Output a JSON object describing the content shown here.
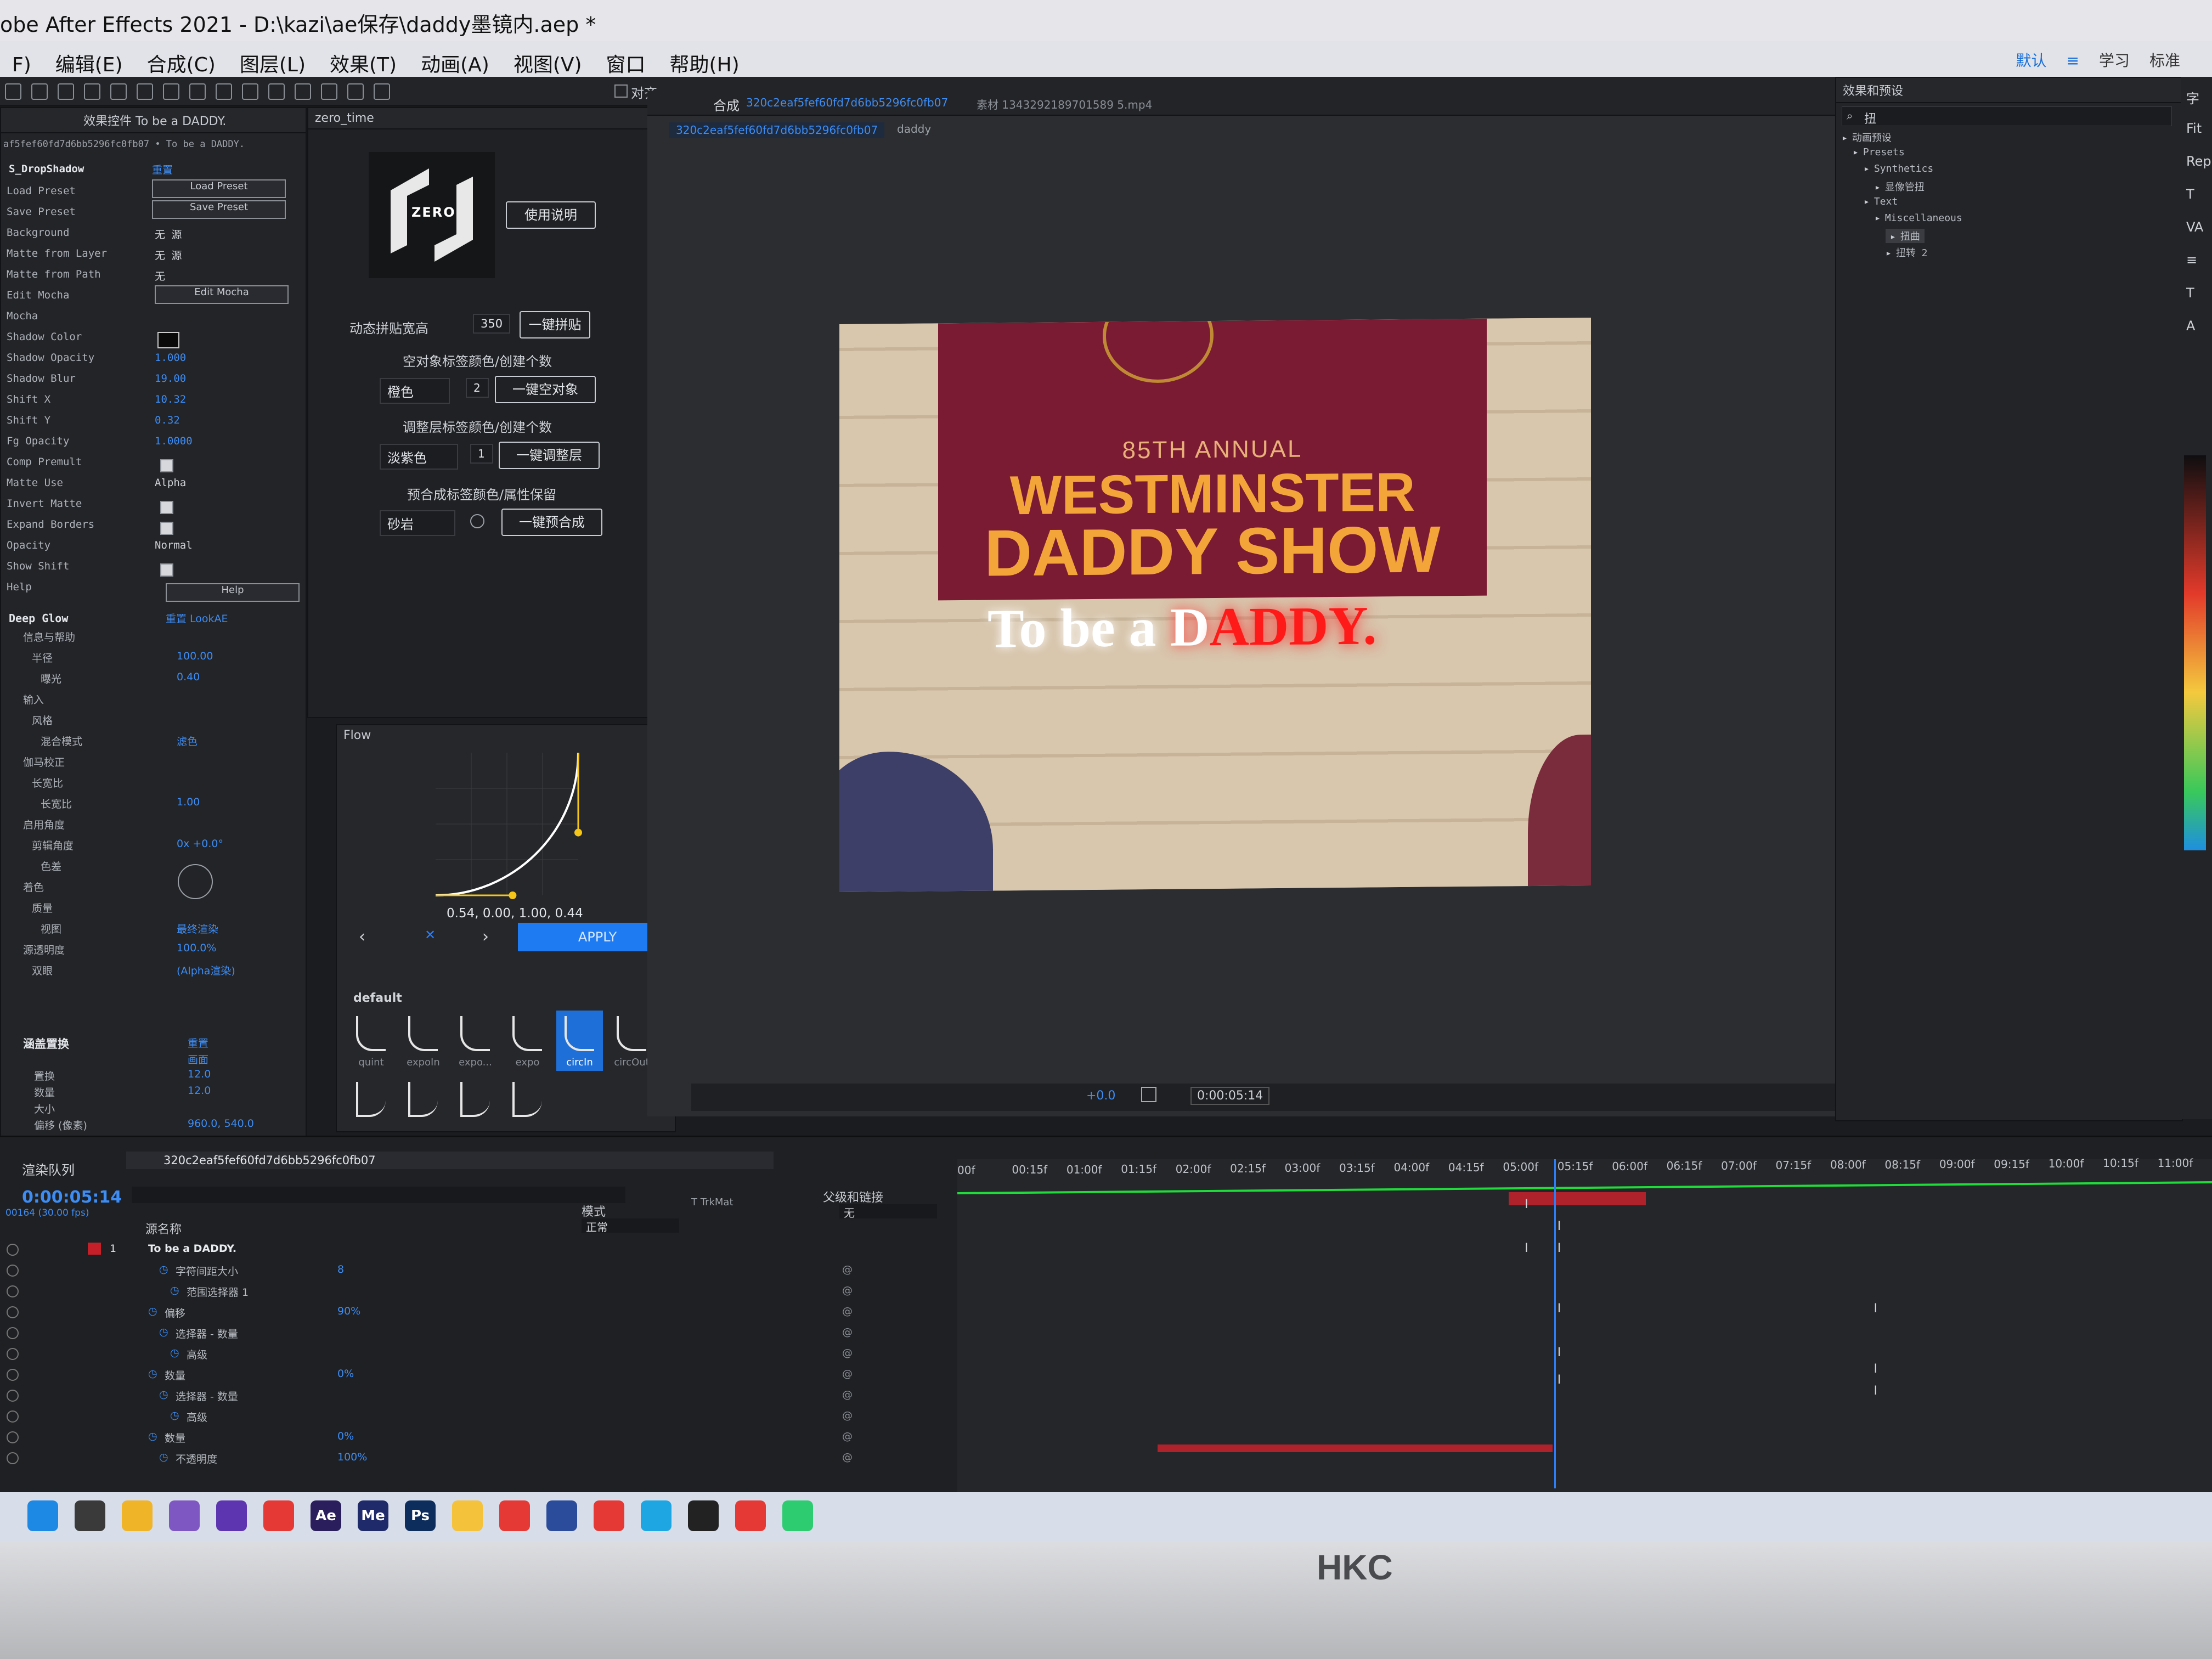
{
  "window": {
    "title": "obe After Effects 2021 - D:\\kazi\\ae保存\\daddy墨镜内.aep *"
  },
  "menu": {
    "items": [
      "F)",
      "编辑(E)",
      "合成(C)",
      "图层(L)",
      "效果(T)",
      "动画(A)",
      "视图(V)",
      "窗口",
      "帮助(H)"
    ],
    "workspace": [
      "默认",
      "≡",
      "学习",
      "标准"
    ]
  },
  "toolbar": {
    "align_label": "对齐"
  },
  "effect_controls": {
    "tab_title": "效果控件 To be a DADDY.",
    "layer_path": "af5fef60fd7d6bb5296fc0fb07 • To be a DADDY.",
    "section1": "S_DropShadow",
    "reset": "重置",
    "load_preset": "Load Preset",
    "save_preset": "Save Preset",
    "edit_mocha": "Edit Mocha",
    "help_button": "Help",
    "rows": [
      {
        "label": "Load Preset",
        "value": ""
      },
      {
        "label": "Save Preset",
        "value": ""
      },
      {
        "label": "Background",
        "value": "无   源"
      },
      {
        "label": "Matte from Layer",
        "value": "无   源"
      },
      {
        "label": "Matte from Path",
        "value": "无"
      },
      {
        "label": "Edit Mocha",
        "value": ""
      },
      {
        "label": "Mocha",
        "value": ""
      },
      {
        "label": "Shadow Color",
        "value": ""
      },
      {
        "label": "Shadow Opacity",
        "value": "1.000"
      },
      {
        "label": "Shadow Blur",
        "value": "19.00"
      },
      {
        "label": "Shift X",
        "value": "10.32"
      },
      {
        "label": "Shift Y",
        "value": "0.32"
      },
      {
        "label": "Fg Opacity",
        "value": "1.0000"
      },
      {
        "label": "Comp Premult",
        "value": ""
      },
      {
        "label": "Matte Use",
        "value": "Alpha"
      },
      {
        "label": "Invert Matte",
        "value": ""
      },
      {
        "label": "Expand Borders",
        "value": ""
      },
      {
        "label": "Opacity",
        "value": "Normal"
      },
      {
        "label": "Show Shift",
        "value": ""
      },
      {
        "label": "Help",
        "value": ""
      }
    ],
    "section2": "Deep Glow",
    "section2_links": "重置   LookAE",
    "rows2": [
      {
        "label": "信息与帮助",
        "value": ""
      },
      {
        "label": "半径",
        "value": "100.00"
      },
      {
        "label": "曝光",
        "value": "0.40"
      },
      {
        "label": "输入",
        "value": ""
      },
      {
        "label": "风格",
        "value": ""
      },
      {
        "label": "混合模式",
        "value": "滤色"
      },
      {
        "label": "伽马校正",
        "value": ""
      },
      {
        "label": "长宽比",
        "value": ""
      },
      {
        "label": "长宽比",
        "value": "1.00"
      },
      {
        "label": "启用角度",
        "value": ""
      },
      {
        "label": "剪辑角度",
        "value": "0x +0.0°"
      },
      {
        "label": "色差",
        "value": ""
      },
      {
        "label": "着色",
        "value": ""
      },
      {
        "label": "质量",
        "value": ""
      },
      {
        "label": "视图",
        "value": "最终渲染"
      },
      {
        "label": "源透明度",
        "value": "100.0%"
      },
      {
        "label": "双眼",
        "value": "(Alpha渲染)"
      }
    ],
    "section3": "涵盖置换",
    "section3_reset": "重置",
    "rows3": [
      {
        "label": "",
        "value": "画面"
      },
      {
        "label": "置换",
        "value": "12.0"
      },
      {
        "label": "数量",
        "value": "12.0"
      },
      {
        "label": "大小",
        "value": ""
      },
      {
        "label": "偏移 (像素)",
        "value": "960.0, 540.0"
      }
    ]
  },
  "zero_panel": {
    "tab": "zero_time",
    "logo_text": "ZERO",
    "manual_button": "使用说明",
    "tile_label": "动态拼贴宽高",
    "tile_value": "350",
    "tile_button": "一键拼贴",
    "null_label": "空对象标签颜色/创建个数",
    "null_color": "橙色",
    "null_count": "2",
    "null_button": "一键空对象",
    "adj_label": "调整层标签颜色/创建个数",
    "adj_color": "淡紫色",
    "adj_count": "1",
    "adj_button": "一键调整层",
    "precomp_label": "预合成标签颜色/属性保留",
    "precomp_color": "砂岩",
    "precomp_button": "一键预合成"
  },
  "flow_panel": {
    "title": "Flow",
    "bezier": "0.54, 0.00, 1.00, 0.44",
    "apply": "APPLY",
    "preset_group": "default",
    "presets": [
      "quint",
      "expoIn",
      "expo...",
      "expo",
      "circIn",
      "circOut"
    ],
    "curve": [
      0.54,
      0.0,
      1.0,
      0.44
    ]
  },
  "composition": {
    "tab_label": "合成",
    "comp_name": "320c2eaf5fef60fd7d6bb5296fc0fb07",
    "footage_tab": "素材 1343292189701589 5.mp4",
    "breadcrumb_child": "daddy",
    "timecode": "0:00:05:14",
    "zoom_offset": "+0.0"
  },
  "video": {
    "banner_line1": "85TH ANNUAL",
    "banner_line2": "WESTMINSTER",
    "banner_line3": "DADDY SHOW",
    "overlay_white": "To be a ",
    "overlay_d": "D",
    "overlay_red": "ADDY."
  },
  "effects_presets": {
    "title": "效果和预设",
    "search_value": "扭",
    "tree": [
      "动画预设",
      "Presets",
      "Synthetics",
      "显像管扭",
      "Text",
      "Miscellaneous",
      "扭曲",
      "扭转 2"
    ]
  },
  "right_panel": {
    "items": [
      "字",
      "Fit",
      "Rep",
      "T",
      "VA",
      "≡",
      "T",
      "A"
    ]
  },
  "timeline": {
    "render_queue": "渲染队列",
    "comp_tab": "320c2eaf5fef60fd7d6bb5296fc0fb07",
    "timecode": "0:00:05:14",
    "frame_info": "00164 (30.00 fps)",
    "col_source": "源名称",
    "col_mode": "模式",
    "col_trkmat": "T  TrkMat",
    "col_parent": "父级和链接",
    "layer_mode": "正常",
    "parent_none": "无",
    "layers": [
      {
        "num": "1",
        "name": "To be a DADDY.",
        "value": ""
      },
      {
        "num": "",
        "name": "字符间距大小",
        "value": "8"
      },
      {
        "num": "",
        "name": "范围选择器 1",
        "value": ""
      },
      {
        "num": "",
        "name": "偏移",
        "value": "90%"
      },
      {
        "num": "",
        "name": "选择器 - 数量",
        "value": ""
      },
      {
        "num": "",
        "name": "高级",
        "value": ""
      },
      {
        "num": "",
        "name": "数量",
        "value": "0%"
      },
      {
        "num": "",
        "name": "选择器 - 数量",
        "value": ""
      },
      {
        "num": "",
        "name": "高级",
        "value": ""
      },
      {
        "num": "",
        "name": "数量",
        "value": "0%"
      },
      {
        "num": "",
        "name": "不透明度",
        "value": "100%"
      }
    ],
    "ruler": [
      "00f",
      "00:15f",
      "01:00f",
      "01:15f",
      "02:00f",
      "02:15f",
      "03:00f",
      "03:15f",
      "04:00f",
      "04:15f",
      "05:00f",
      "05:15f",
      "06:00f",
      "06:15f",
      "07:00f",
      "07:15f",
      "08:00f",
      "08:15f",
      "09:00f",
      "09:15f",
      "10:00f",
      "10:15f",
      "11:00f"
    ],
    "playhead_time": 5.47
  },
  "taskbar": {
    "icons": [
      "windows-icon",
      "search-icon",
      "folder-icon",
      "photos-icon",
      "obs-icon",
      "youtube-icon",
      "ae-icon",
      "me-icon",
      "ps-icon",
      "files-icon",
      "app-icon",
      "security-icon",
      "youtube-icon",
      "edge-icon",
      "qq-icon",
      "youtube-icon",
      "wechat-icon"
    ],
    "labels": {
      "ae": "Ae",
      "me": "Me",
      "ps": "Ps"
    }
  },
  "monitor": {
    "brand": "HKC"
  },
  "colors": {
    "accent": "#2d7ff9",
    "panel_bg": "#232428",
    "banner": "#7b1b33",
    "banner_text": "#f2a33a",
    "overlay_red": "#ff1a1a",
    "timeline_green": "#1fdc3a",
    "work_red": "#b0222b"
  }
}
